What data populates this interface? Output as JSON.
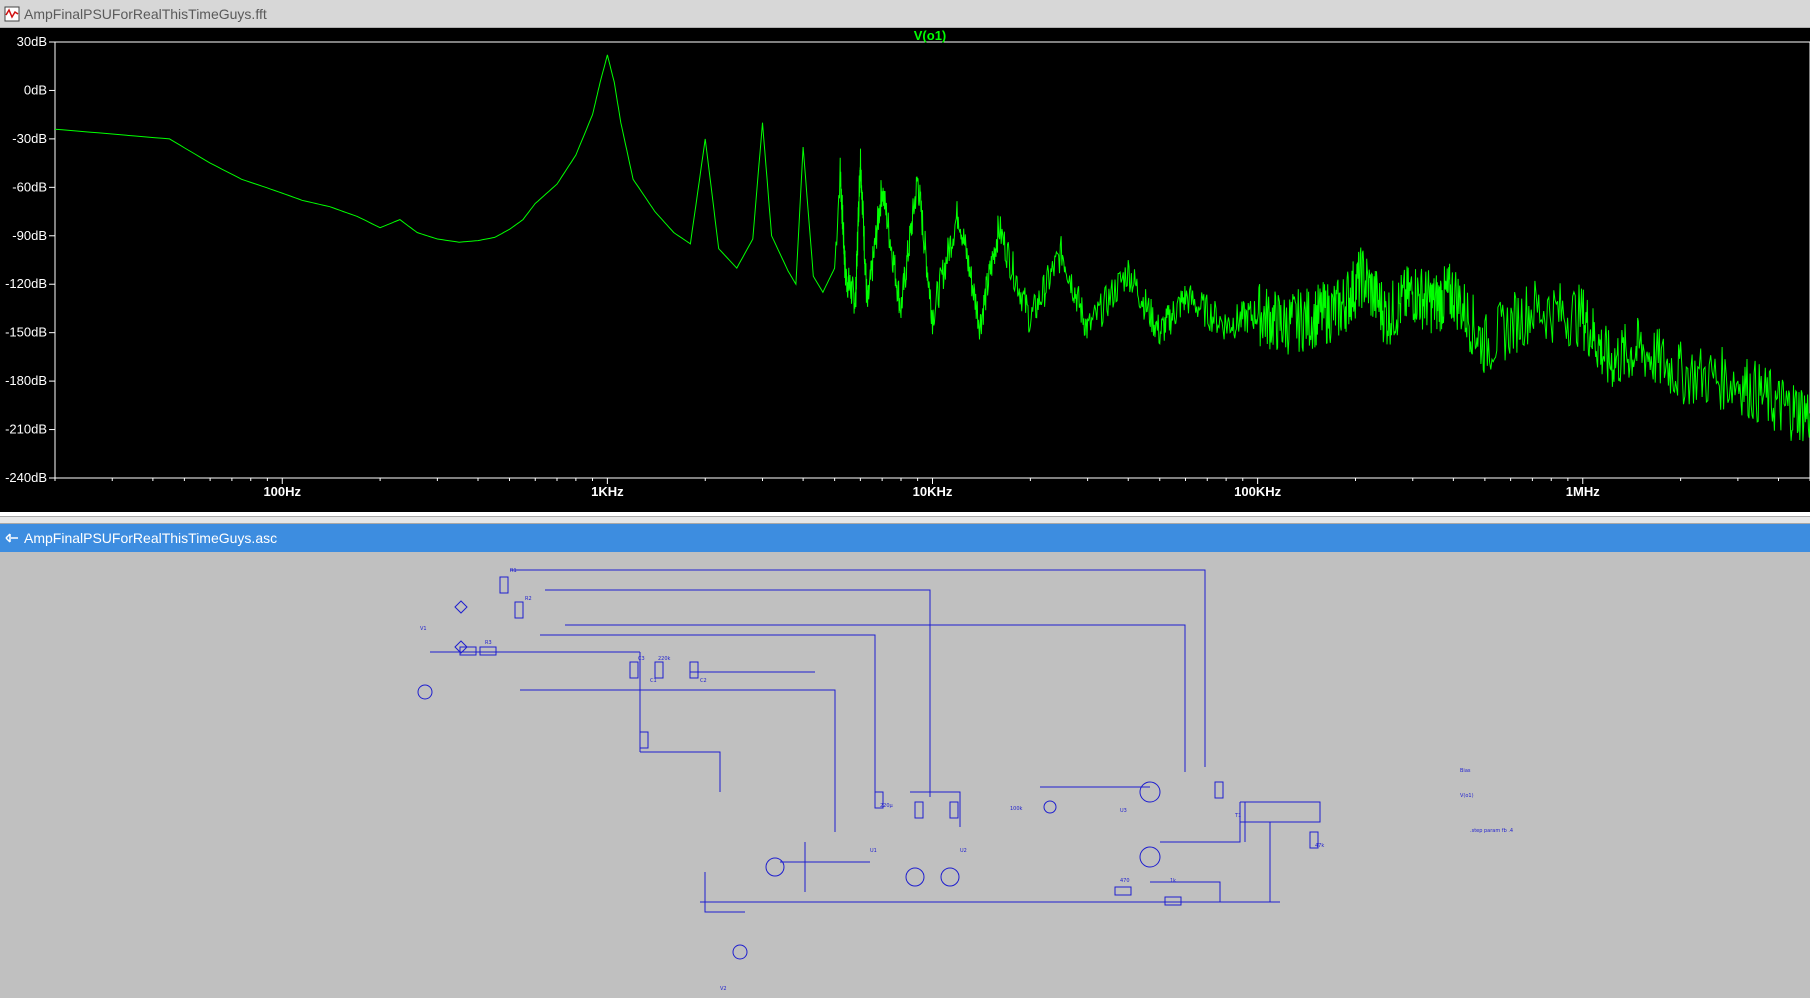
{
  "windows": {
    "fft_title": "AmpFinalPSUForRealThisTimeGuys.fft",
    "asc_title": "AmpFinalPSUForRealThisTimeGuys.asc"
  },
  "icons": {
    "fft_window": "waveform-window-icon",
    "asc_window": "schematic-window-icon"
  },
  "chart_data": {
    "type": "line",
    "title": "V(o1)",
    "x_scale": "log",
    "y_unit": "dB",
    "xlim": [
      20,
      5000000
    ],
    "ylim": [
      -240,
      30
    ],
    "y_ticks": [
      "30dB",
      "0dB",
      "-30dB",
      "-60dB",
      "-90dB",
      "-120dB",
      "-150dB",
      "-180dB",
      "-210dB",
      "-240dB"
    ],
    "y_tick_values": [
      30,
      0,
      -30,
      -60,
      -90,
      -120,
      -150,
      -180,
      -210,
      -240
    ],
    "x_ticks": [
      "100Hz",
      "1KHz",
      "10KHz",
      "100KHz",
      "1MHz"
    ],
    "x_tick_values": [
      100,
      1000,
      10000,
      100000,
      1000000
    ],
    "grid": false,
    "line_color": "#00ff00",
    "series": [
      {
        "name": "V(o1)",
        "points": [
          [
            20,
            -24
          ],
          [
            30,
            -27
          ],
          [
            45,
            -30
          ],
          [
            60,
            -45
          ],
          [
            75,
            -55
          ],
          [
            95,
            -62
          ],
          [
            115,
            -68
          ],
          [
            140,
            -72
          ],
          [
            170,
            -78
          ],
          [
            200,
            -85
          ],
          [
            230,
            -80
          ],
          [
            260,
            -88
          ],
          [
            300,
            -92
          ],
          [
            350,
            -94
          ],
          [
            400,
            -93
          ],
          [
            450,
            -91
          ],
          [
            500,
            -86
          ],
          [
            550,
            -80
          ],
          [
            600,
            -70
          ],
          [
            700,
            -58
          ],
          [
            800,
            -40
          ],
          [
            900,
            -15
          ],
          [
            950,
            5
          ],
          [
            1000,
            22
          ],
          [
            1050,
            5
          ],
          [
            1100,
            -20
          ],
          [
            1200,
            -55
          ],
          [
            1400,
            -75
          ],
          [
            1600,
            -88
          ],
          [
            1800,
            -95
          ],
          [
            2000,
            -30
          ],
          [
            2200,
            -98
          ],
          [
            2500,
            -110
          ],
          [
            2800,
            -92
          ],
          [
            3000,
            -20
          ],
          [
            3200,
            -90
          ],
          [
            3600,
            -112
          ],
          [
            3800,
            -120
          ],
          [
            4000,
            -35
          ],
          [
            4300,
            -115
          ],
          [
            4600,
            -125
          ],
          [
            5000,
            -110
          ],
          [
            5200,
            -50
          ],
          [
            5400,
            -115
          ],
          [
            5800,
            -130
          ],
          [
            6000,
            -40
          ],
          [
            6300,
            -135
          ],
          [
            7000,
            -60
          ],
          [
            8000,
            -135
          ],
          [
            9000,
            -55
          ],
          [
            10000,
            -140
          ],
          [
            12000,
            -75
          ],
          [
            14000,
            -145
          ],
          [
            16000,
            -85
          ],
          [
            20000,
            -142
          ],
          [
            25000,
            -100
          ],
          [
            30000,
            -148
          ],
          [
            40000,
            -112
          ],
          [
            50000,
            -150
          ],
          [
            60000,
            -128
          ],
          [
            80000,
            -145
          ],
          [
            100000,
            -138
          ],
          [
            120000,
            -145
          ],
          [
            150000,
            -140
          ],
          [
            180000,
            -135
          ],
          [
            210000,
            -115
          ],
          [
            250000,
            -140
          ],
          [
            300000,
            -125
          ],
          [
            350000,
            -132
          ],
          [
            400000,
            -125
          ],
          [
            500000,
            -158
          ],
          [
            700000,
            -135
          ],
          [
            1000000,
            -140
          ],
          [
            1200000,
            -168
          ],
          [
            1500000,
            -160
          ],
          [
            2000000,
            -175
          ],
          [
            3000000,
            -180
          ],
          [
            4000000,
            -195
          ],
          [
            5000000,
            -200
          ]
        ]
      }
    ]
  },
  "schematic": {
    "labels": [
      "Bias",
      ".step param fb .4",
      "V1",
      "V2",
      "U1",
      "U2",
      "U3",
      "T1",
      "R1",
      "R2",
      "R3",
      "C1",
      "C2",
      "C3",
      "220k",
      "220µ",
      "100k",
      "470",
      "1k",
      "47k",
      "V(o1)"
    ]
  }
}
